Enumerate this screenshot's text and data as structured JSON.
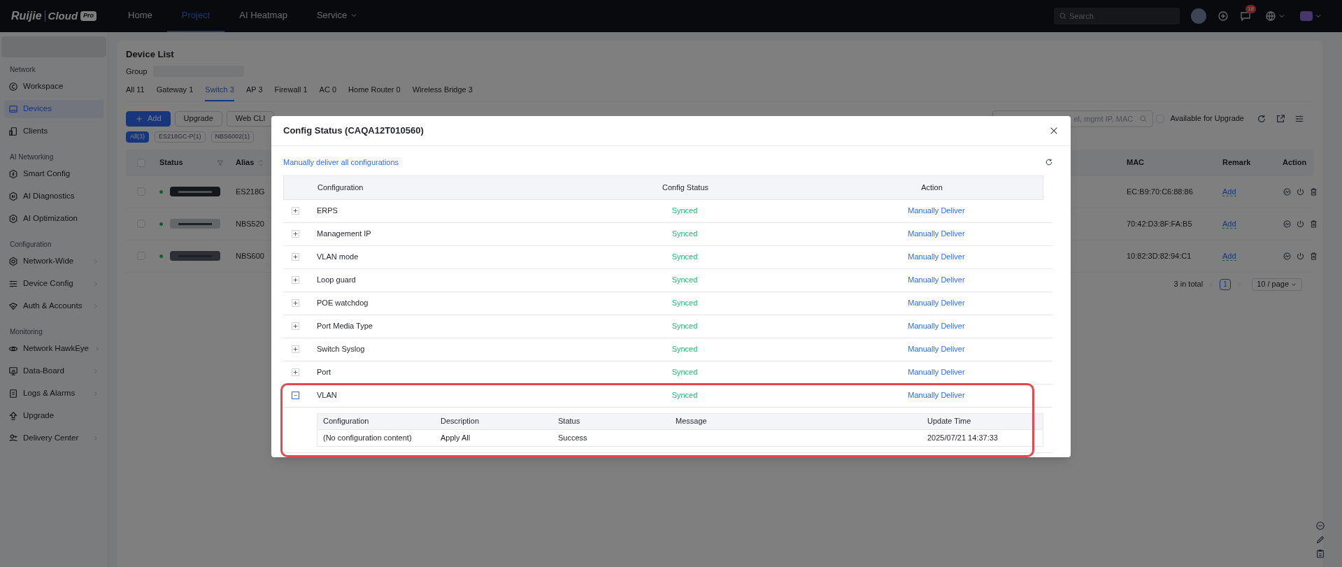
{
  "topbar": {
    "logo": "Ruijie",
    "logo_product": "Cloud",
    "logo_badge": "Pro",
    "nav": [
      {
        "label": "Home",
        "selected": false,
        "dropdown": false
      },
      {
        "label": "Project",
        "selected": true,
        "dropdown": false
      },
      {
        "label": "AI Heatmap",
        "selected": false,
        "dropdown": false
      },
      {
        "label": "Service",
        "selected": false,
        "dropdown": true
      }
    ],
    "search": {
      "placeholder": "Search"
    },
    "notification_count": "18"
  },
  "sidebar": {
    "sections": [
      {
        "title": "Network",
        "items": [
          {
            "label": "Workspace",
            "selected": false,
            "expandable": false
          },
          {
            "label": "Devices",
            "selected": true,
            "expandable": false
          },
          {
            "label": "Clients",
            "selected": false,
            "expandable": false
          }
        ]
      },
      {
        "title": "AI Networking",
        "items": [
          {
            "label": "Smart Config",
            "selected": false,
            "expandable": false
          },
          {
            "label": "AI Diagnostics",
            "selected": false,
            "expandable": false
          },
          {
            "label": "AI Optimization",
            "selected": false,
            "expandable": false
          }
        ]
      },
      {
        "title": "Configuration",
        "items": [
          {
            "label": "Network-Wide",
            "selected": false,
            "expandable": true
          },
          {
            "label": "Device Config",
            "selected": false,
            "expandable": true
          },
          {
            "label": "Auth & Accounts",
            "selected": false,
            "expandable": true
          }
        ]
      },
      {
        "title": "Monitoring",
        "items": [
          {
            "label": "Network HawkEye",
            "selected": false,
            "expandable": true
          },
          {
            "label": "Data-Board",
            "selected": false,
            "expandable": true
          },
          {
            "label": "Logs & Alarms",
            "selected": false,
            "expandable": true
          },
          {
            "label": "Upgrade",
            "selected": false,
            "expandable": false
          },
          {
            "label": "Delivery Center",
            "selected": false,
            "expandable": true
          }
        ]
      }
    ]
  },
  "device_list": {
    "title": "Device List",
    "group_label": "Group",
    "tabs": [
      {
        "label": "All 11",
        "selected": false
      },
      {
        "label": "Gateway 1",
        "selected": false
      },
      {
        "label": "Switch 3",
        "selected": true
      },
      {
        "label": "AP 3",
        "selected": false
      },
      {
        "label": "Firewall 1",
        "selected": false
      },
      {
        "label": "AC 0",
        "selected": false
      },
      {
        "label": "Home Router 0",
        "selected": false
      },
      {
        "label": "Wireless Bridge 3",
        "selected": false
      }
    ],
    "buttons": [
      {
        "label": "Add",
        "kind": "primary"
      },
      {
        "label": "Upgrade",
        "kind": "default"
      },
      {
        "label": "Web CLI",
        "kind": "default"
      }
    ],
    "filters": [
      {
        "label": "All(3)",
        "selected": true
      },
      {
        "label": "ES218GC-P(1)",
        "selected": false
      },
      {
        "label": "NBS6002(1)",
        "selected": false
      }
    ],
    "search": {
      "placeholder": "el, mgmt IP, MAC"
    },
    "upgrade_filter": {
      "label": "Available for Upgrade",
      "checked": false
    },
    "table": {
      "columns": [
        "Status",
        "Alias",
        "MAC",
        "Remark",
        "Action"
      ],
      "all_checked": false,
      "rows": [
        {
          "checked": false,
          "online": true,
          "alias": "ES218G",
          "mac": "EC:B9:70:C6:88:86",
          "remark": "Add"
        },
        {
          "checked": false,
          "online": true,
          "alias": "NBS520",
          "mac": "70:42:D3:8F:FA:B5",
          "remark": "Add"
        },
        {
          "checked": false,
          "online": true,
          "alias": "NBS600",
          "mac": "10:82:3D:82:94:C1",
          "remark": "Add"
        }
      ]
    },
    "pagination": {
      "total": "3 in total",
      "pages": [
        {
          "label": "1",
          "selected": true
        }
      ],
      "page_size": "10 / page"
    }
  },
  "dialog": {
    "title": "Config Status (CAQA12T010560)",
    "link": "Manually deliver all configurations",
    "columns": [
      "Configuration",
      "Config Status",
      "Action"
    ],
    "rows": [
      {
        "name": "ERPS",
        "status": "Synced",
        "action": "Manually Deliver",
        "expanded": false
      },
      {
        "name": "Management IP",
        "status": "Synced",
        "action": "Manually Deliver",
        "expanded": false
      },
      {
        "name": "VLAN mode",
        "status": "Synced",
        "action": "Manually Deliver",
        "expanded": false
      },
      {
        "name": "Loop guard",
        "status": "Synced",
        "action": "Manually Deliver",
        "expanded": false
      },
      {
        "name": "POE watchdog",
        "status": "Synced",
        "action": "Manually Deliver",
        "expanded": false
      },
      {
        "name": "Port Media Type",
        "status": "Synced",
        "action": "Manually Deliver",
        "expanded": false
      },
      {
        "name": "Switch Syslog",
        "status": "Synced",
        "action": "Manually Deliver",
        "expanded": false
      },
      {
        "name": "Port",
        "status": "Synced",
        "action": "Manually Deliver",
        "expanded": false
      },
      {
        "name": "VLAN",
        "status": "Synced",
        "action": "Manually Deliver",
        "expanded": true,
        "highlighted": true,
        "detail": {
          "columns": [
            "Configuration",
            "Description",
            "Status",
            "Message",
            "Update Time"
          ],
          "rows": [
            {
              "configuration": "(No configuration content)",
              "description": "Apply All",
              "status": "Success",
              "update_time": "2025/07/21 14:37:33"
            }
          ]
        }
      }
    ]
  }
}
